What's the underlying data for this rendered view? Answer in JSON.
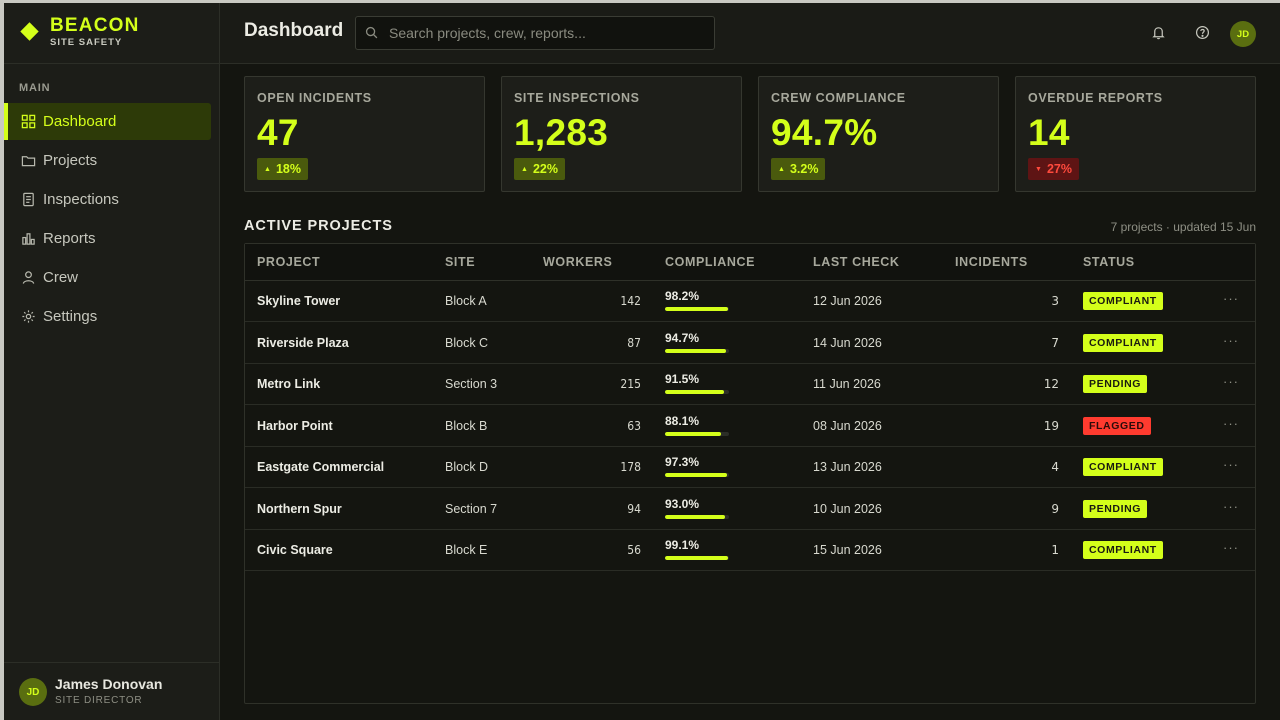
{
  "brand": {
    "name": "BEACON",
    "subtitle": "SITE SAFETY",
    "accent": "#d4ff1a"
  },
  "sidebar": {
    "section_label": "MAIN",
    "items": [
      {
        "label": "Dashboard",
        "icon": "grid-icon",
        "active": true
      },
      {
        "label": "Projects",
        "icon": "folder-icon"
      },
      {
        "label": "Inspections",
        "icon": "document-icon"
      },
      {
        "label": "Reports",
        "icon": "bar-chart-icon"
      },
      {
        "label": "Crew",
        "icon": "person-icon"
      },
      {
        "label": "Settings",
        "icon": "gear-icon"
      }
    ],
    "user": {
      "initials": "JD",
      "name": "James Donovan",
      "role": "SITE DIRECTOR"
    }
  },
  "header": {
    "title": "Dashboard",
    "search_placeholder": "Search projects, crew, reports...",
    "icons": [
      "bell-icon",
      "help-icon"
    ],
    "avatar_initials": "JD"
  },
  "stats": [
    {
      "label": "OPEN INCIDENTS",
      "value": "47",
      "change": "18%",
      "direction": "up"
    },
    {
      "label": "SITE INSPECTIONS",
      "value": "1,283",
      "change": "22%",
      "direction": "up"
    },
    {
      "label": "CREW COMPLIANCE",
      "value": "94.7%",
      "change": "3.2%",
      "direction": "up"
    },
    {
      "label": "OVERDUE REPORTS",
      "value": "14",
      "change": "27%",
      "direction": "down"
    }
  ],
  "projects": {
    "title": "ACTIVE PROJECTS",
    "meta": "7 projects · updated 15 Jun",
    "columns": [
      "PROJECT",
      "SITE",
      "WORKERS",
      "COMPLIANCE",
      "LAST CHECK",
      "INCIDENTS",
      "STATUS"
    ],
    "rows": [
      {
        "project": "Skyline Tower",
        "site": "Block A",
        "workers": "142",
        "compliance": "98.2%",
        "compliance_value": 98.2,
        "last_check": "12 Jun 2026",
        "incidents": "3",
        "status": "COMPLIANT"
      },
      {
        "project": "Riverside Plaza",
        "site": "Block C",
        "workers": "87",
        "compliance": "94.7%",
        "compliance_value": 94.7,
        "last_check": "14 Jun 2026",
        "incidents": "7",
        "status": "COMPLIANT"
      },
      {
        "project": "Metro Link",
        "site": "Section 3",
        "workers": "215",
        "compliance": "91.5%",
        "compliance_value": 91.5,
        "last_check": "11 Jun 2026",
        "incidents": "12",
        "status": "PENDING"
      },
      {
        "project": "Harbor Point",
        "site": "Block B",
        "workers": "63",
        "compliance": "88.1%",
        "compliance_value": 88.1,
        "last_check": "08 Jun 2026",
        "incidents": "19",
        "status": "FLAGGED"
      },
      {
        "project": "Eastgate Commercial",
        "site": "Block D",
        "workers": "178",
        "compliance": "97.3%",
        "compliance_value": 97.3,
        "last_check": "13 Jun 2026",
        "incidents": "4",
        "status": "COMPLIANT"
      },
      {
        "project": "Northern Spur",
        "site": "Section 7",
        "workers": "94",
        "compliance": "93.0%",
        "compliance_value": 93.0,
        "last_check": "10 Jun 2026",
        "incidents": "9",
        "status": "PENDING"
      },
      {
        "project": "Civic Square",
        "site": "Block E",
        "workers": "56",
        "compliance": "99.1%",
        "compliance_value": 99.1,
        "last_check": "15 Jun 2026",
        "incidents": "1",
        "status": "COMPLIANT"
      }
    ]
  }
}
